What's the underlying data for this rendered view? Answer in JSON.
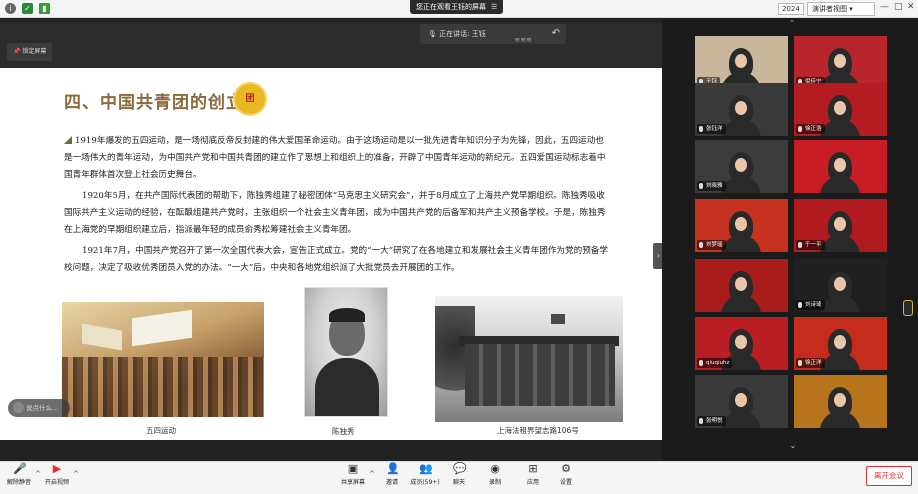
{
  "window": {
    "share_banner": "您正在观看王钰的屏幕",
    "resolution": "2024",
    "view_label": "演讲者视图",
    "controls": [
      "—",
      "□",
      "✕"
    ]
  },
  "toolbar_top": {
    "pin_label": "锁定屏幕",
    "speaker_label": "正在讲话: 王钰"
  },
  "slide": {
    "title": "四、中国共青团的创立",
    "badge": "团",
    "paragraphs": [
      "1919年爆发的五四运动，是一场彻底反帝反封建的伟大爱国革命运动。由于这场运动是以一批先进青年知识分子为先锋，因此，五四运动也是一场伟大的青年运动，为中国共产党和中国共青团的建立作了思想上和组织上的准备，开辟了中国青年运动的新纪元。五四爱国运动标志着中国青年群体首次登上社会历史舞台。",
      "1920年5月，在共产国际代表团的帮助下，陈独秀组建了秘密团体“马克思主义研究会”，并于8月成立了上海共产党早期组织。陈独秀吸收国际共产主义运动的经验，在酝酿组建共产党时，主张组织一个社会主义青年团，成为中国共产党的后备军和共产主义预备学校。于是，陈独秀在上海党的早期组织建立后，指派最年轻的成员俞秀松筹建社会主义青年团。",
      "1921年7月，中国共产党召开了第一次全国代表大会，宣告正式成立。党的“一大”研究了在各地建立和发展社会主义青年团作为党的预备学校问题，决定了吸收优秀团员入党的办法。“一大”后，中央和各地党组织派了大批党员去开展团的工作。"
    ],
    "captions": [
      "五四运动",
      "陈独秀",
      "上海法租界望志路106号"
    ],
    "chat_placeholder": "说点什么..."
  },
  "gallery": {
    "tiles": [
      {
        "name": "王钰",
        "bg": "#c9b79c"
      },
      {
        "name": "倪佳宁",
        "bg": "#b8262b"
      },
      {
        "name": "张钰洋",
        "bg": "#3a3a3a"
      },
      {
        "name": "徐正浩",
        "bg": "#b51c22"
      },
      {
        "name": "刘晓雅",
        "bg": "#3c3c3c"
      },
      {
        "name": "",
        "bg": "#c81d24"
      },
      {
        "name": "刘梦瑶",
        "bg": "#c6321f"
      },
      {
        "name": "于一平",
        "bg": "#b11b1f"
      },
      {
        "name": "",
        "bg": "#a81c1c"
      },
      {
        "name": "刘诗琦",
        "bg": "#202020"
      },
      {
        "name": "qiuqiuhz",
        "bg": "#b81e24"
      },
      {
        "name": "徐正洋",
        "bg": "#c52c1c"
      },
      {
        "name": "张明悦",
        "bg": "#3a3a3a"
      },
      {
        "name": "",
        "bg": "#b8741d"
      }
    ]
  },
  "bottom": {
    "mute": "解除静音",
    "video": "开启视频",
    "share": "共享屏幕",
    "invite": "邀请",
    "members": "成员(59+)",
    "chat": "聊天",
    "record": "录制",
    "apps": "应用",
    "settings": "设置",
    "leave": "离开会议"
  },
  "colors": {
    "accent_red": "#dd3333",
    "title_brown": "#8c6a3e"
  }
}
